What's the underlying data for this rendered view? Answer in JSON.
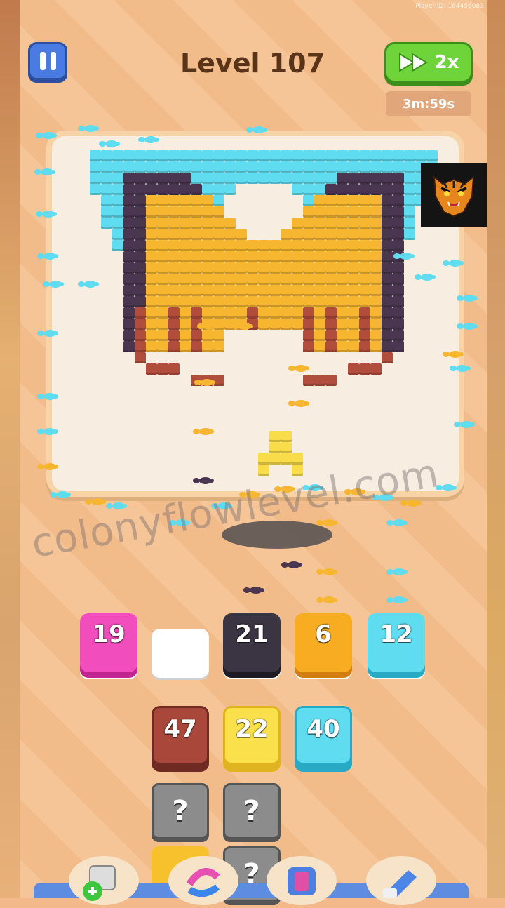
{
  "header": {
    "player_id": "Player ID: 164456083",
    "level_title": "Level 107",
    "speed_label": "2x",
    "timer": "3m:59s"
  },
  "watermark": "colonyflowlevel.com",
  "colors": {
    "cyan": "#5fdcf0",
    "purple": "#4b3651",
    "yellow": "#f7b630",
    "brown": "#b04d3c",
    "pink": "#ee3fb6",
    "dark": "#3a3340",
    "orange": "#f6a623",
    "light_yellow": "#f9dc49"
  },
  "slots": [
    {
      "value": "19",
      "color": "pink"
    },
    {
      "value": "",
      "color": "empty"
    },
    {
      "value": "21",
      "color": "dark"
    },
    {
      "value": "6",
      "color": "orange"
    },
    {
      "value": "12",
      "color": "cyan"
    }
  ],
  "queue": [
    {
      "value": "47",
      "color": "brown"
    },
    {
      "value": "22",
      "color": "light_yellow"
    },
    {
      "value": "40",
      "color": "cyan"
    }
  ],
  "mystery_label": "?",
  "tiger_icon": "tiger-head-icon",
  "tools": [
    "add-tile-icon",
    "shuffle-icon",
    "magnet-icon",
    "vacuum-icon"
  ]
}
